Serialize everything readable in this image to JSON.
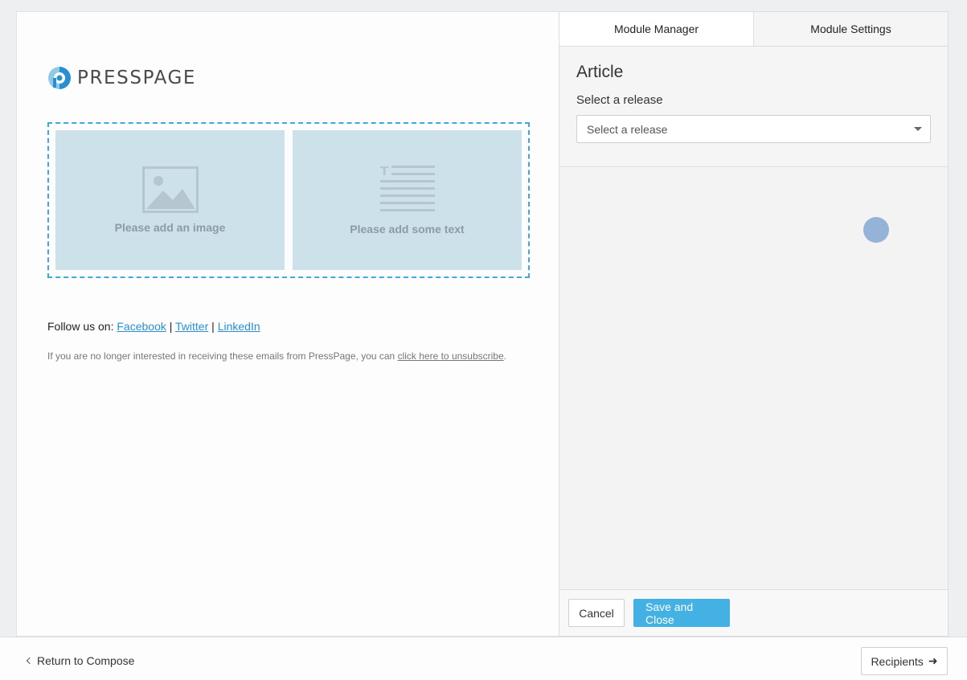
{
  "email": {
    "logo_text": "PRESSPAGE",
    "image_placeholder": "Please add an image",
    "text_placeholder": "Please add some text",
    "follow_prefix": "Follow us on:",
    "social_links": [
      "Facebook",
      "Twitter",
      "LinkedIn"
    ],
    "separator": "|",
    "unsubscribe_text": "If you are no longer interested in receiving these emails from PressPage, you can",
    "unsubscribe_link": "click here to unsubscribe",
    "unsubscribe_end": "."
  },
  "panel": {
    "tabs": [
      {
        "label": "Module Manager",
        "active": true
      },
      {
        "label": "Module Settings",
        "active": false
      }
    ],
    "title": "Article",
    "field_label": "Select a release",
    "select_placeholder": "Select a release",
    "cancel_label": "Cancel",
    "save_label": "Save and Close"
  },
  "footer": {
    "back_label": "Return to Compose",
    "next_label": "Recipients"
  },
  "colors": {
    "accent": "#43b1e3",
    "dashed_border": "#3ea9dc",
    "placeholder_bg": "#cde1eb",
    "logo_blue": "#2a8fd0"
  },
  "icons": {
    "logo": "presspage-logo-icon",
    "image": "image-placeholder-icon",
    "text": "text-placeholder-icon",
    "dropdown": "caret-down-icon",
    "back": "chevron-left-icon",
    "next": "arrow-right-icon"
  }
}
